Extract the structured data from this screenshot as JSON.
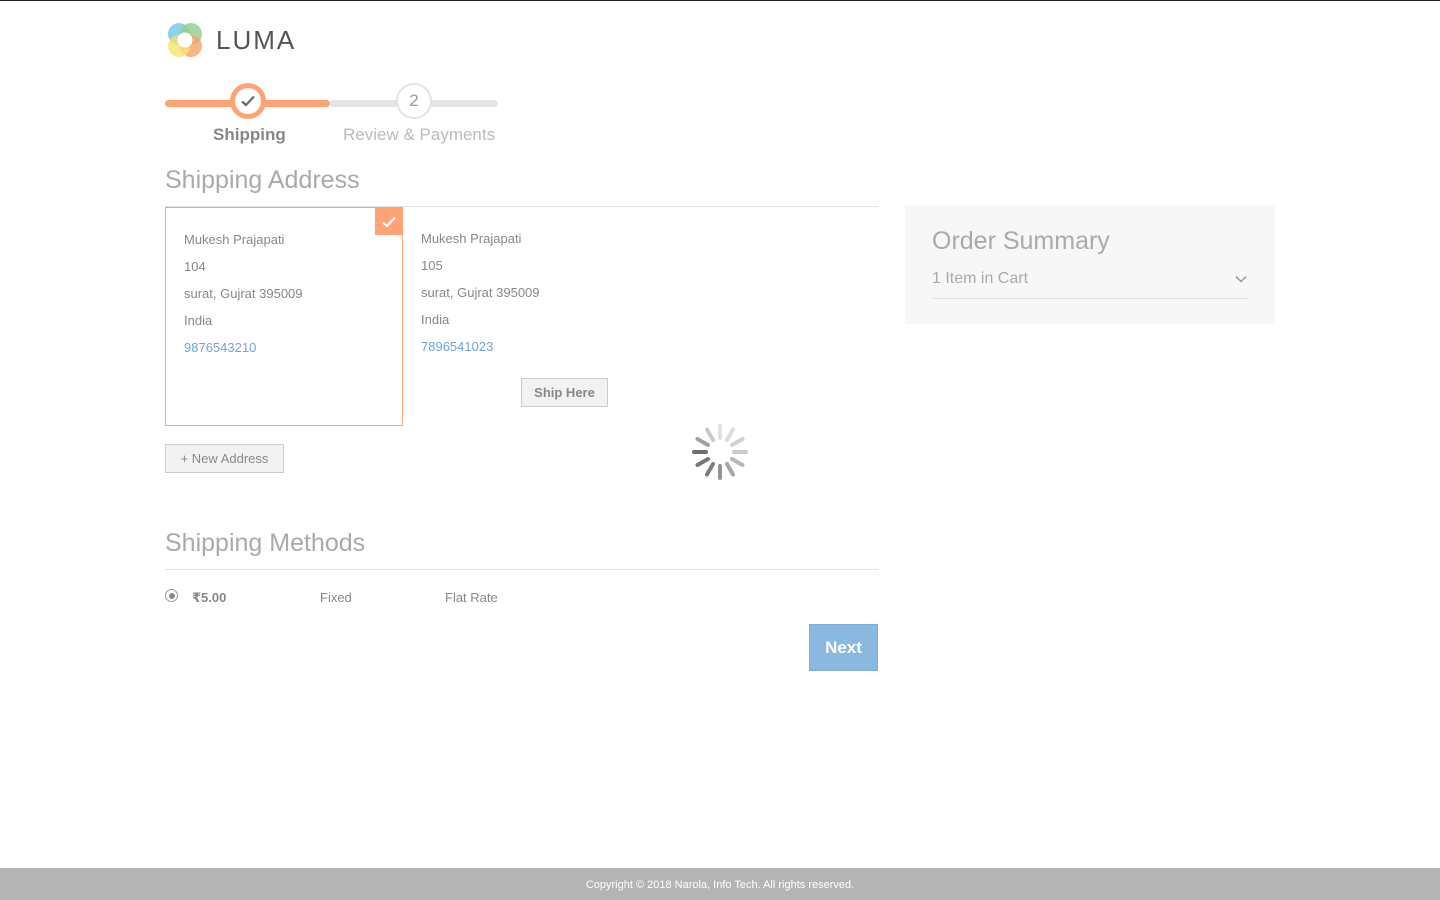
{
  "brand": {
    "name": "LUMA"
  },
  "progress": {
    "steps": [
      {
        "label": "Shipping",
        "number": "1",
        "state": "completed"
      },
      {
        "label": "Review & Payments",
        "number": "2",
        "state": "pending"
      }
    ]
  },
  "shipping_address": {
    "title": "Shipping Address",
    "addresses": [
      {
        "name": "Mukesh Prajapati",
        "street": "104",
        "city_line": "surat, Gujrat 395009",
        "country": "India",
        "phone": "9876543210",
        "selected": true
      },
      {
        "name": "Mukesh Prajapati",
        "street": "105",
        "city_line": "surat, Gujrat 395009",
        "country": "India",
        "phone": "7896541023",
        "selected": false
      }
    ],
    "ship_here_label": "Ship Here",
    "new_address_label": "+ New Address"
  },
  "shipping_methods": {
    "title": "Shipping Methods",
    "methods": [
      {
        "price": "₹5.00",
        "method": "Fixed",
        "carrier": "Flat Rate",
        "selected": true
      }
    ]
  },
  "next_label": "Next",
  "order_summary": {
    "title": "Order Summary",
    "items_label": "1 Item in Cart"
  },
  "footer": {
    "copyright": "Copyright © 2018 Narola, Info Tech. All rights reserved."
  },
  "colors": {
    "accent": "#ff5501",
    "link": "#6fa4d8",
    "primary_button": "#8ab8e0"
  },
  "icons": {
    "logo": "luma-logo-icon",
    "check": "check-icon",
    "chevron": "chevron-down-icon",
    "loader": "loading-spinner-icon"
  }
}
